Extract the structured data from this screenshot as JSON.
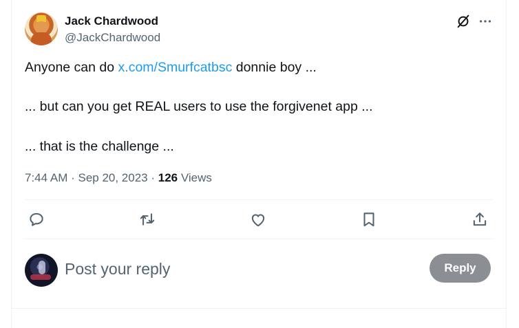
{
  "author": {
    "name": "Jack Chardwood",
    "handle": "@JackChardwood"
  },
  "tweet": {
    "line1_before_link": "Anyone can do ",
    "link_text": "x.com/Smurfcatbsc",
    "line1_after_link": " donnie boy ...",
    "line2": "... but can you get REAL users to use the forgivenet app ...",
    "line3": "... that is the challenge ..."
  },
  "meta": {
    "time": "7:44 AM",
    "date": "Sep 20, 2023",
    "separator": " · ",
    "views_count": "126",
    "views_label": " Views"
  },
  "actions": [
    {
      "icon": "reply-icon"
    },
    {
      "icon": "retweet-icon"
    },
    {
      "icon": "like-icon"
    },
    {
      "icon": "bookmark-icon"
    },
    {
      "icon": "share-icon"
    }
  ],
  "composer": {
    "placeholder": "Post your reply",
    "button_label": "Reply"
  },
  "colors": {
    "link": "#1d9bf0",
    "muted": "#536471",
    "reply_button_disabled": "#8b8f94"
  }
}
